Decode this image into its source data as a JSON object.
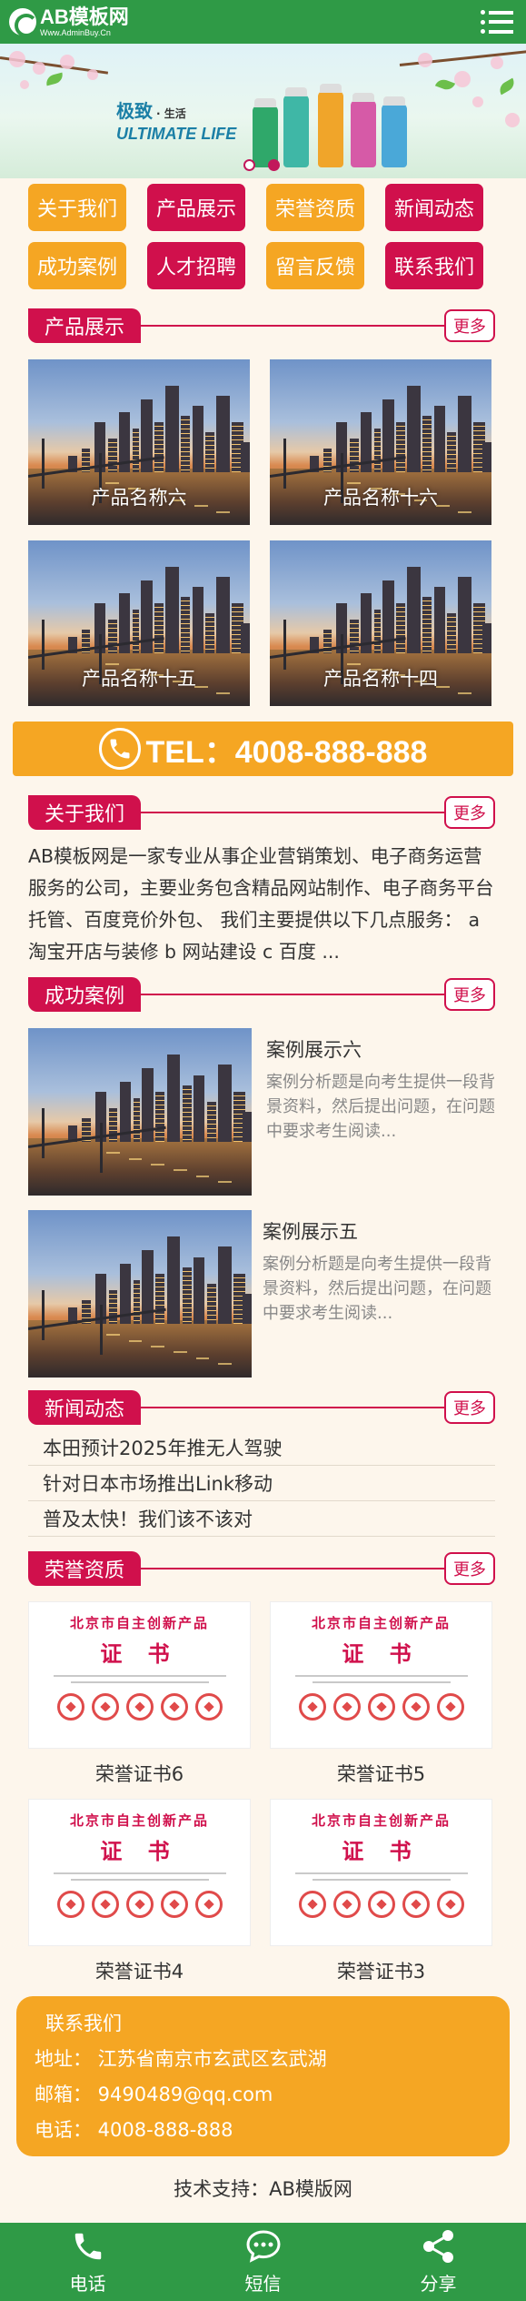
{
  "header": {
    "logo_name": "AB模板网",
    "logo_url": "Www.AdminBuy.Cn",
    "menu_icon": "menu-icon"
  },
  "banner": {
    "title_cn": "极致",
    "title_cn_suffix": "· 生活",
    "title_en": "ULTIMATE LIFE",
    "active_slide": 2,
    "slide_count": 2
  },
  "nav": {
    "items": [
      {
        "label": "关于我们",
        "color": "#f5a623"
      },
      {
        "label": "产品展示",
        "color": "#d0104c"
      },
      {
        "label": "荣誉资质",
        "color": "#f5a623"
      },
      {
        "label": "新闻动态",
        "color": "#d0104c"
      },
      {
        "label": "成功案例",
        "color": "#f5a623"
      },
      {
        "label": "人才招聘",
        "color": "#d0104c"
      },
      {
        "label": "留言反馈",
        "color": "#f5a623"
      },
      {
        "label": "联系我们",
        "color": "#d0104c"
      }
    ]
  },
  "sections": {
    "products": {
      "title": "产品展示",
      "more": "更多"
    },
    "about": {
      "title": "关于我们",
      "more": "更多"
    },
    "cases": {
      "title": "成功案例",
      "more": "更多"
    },
    "news": {
      "title": "新闻动态",
      "more": "更多"
    },
    "honors": {
      "title": "荣誉资质",
      "more": "更多"
    }
  },
  "products": [
    {
      "name": "产品名称六"
    },
    {
      "name": "产品名称十六"
    },
    {
      "name": "产品名称十五"
    },
    {
      "name": "产品名称十四"
    }
  ],
  "tel": {
    "text": "TEL：4008-888-888",
    "icon": "phone-icon"
  },
  "about": {
    "text": "AB模板网是一家专业从事企业营销策划、电子商务运营服务的公司，主要业务包含精品网站制作、电子商务平台托管、百度竞价外包、 我们主要提供以下几点服务： a 淘宝开店与装修 b 网站建设 c 百度 ..."
  },
  "cases": [
    {
      "title": "案例展示六",
      "desc": "案例分析题是向考生提供一段背景资料，然后提出问题，在问题中要求考生阅读..."
    },
    {
      "title": "案例展示五",
      "desc": "案例分析题是向考生提供一段背景资料，然后提出问题，在问题中要求考生阅读..."
    }
  ],
  "news": [
    {
      "title": "本田预计2025年推无人驾驶"
    },
    {
      "title": "针对日本市场推出Link移动"
    },
    {
      "title": "普及太快！我们该不该对"
    }
  ],
  "honors": [
    {
      "name": "荣誉证书6",
      "cert_header": "北京市自主创新产品",
      "cert_title": "证 书"
    },
    {
      "name": "荣誉证书5",
      "cert_header": "北京市自主创新产品",
      "cert_title": "证 书"
    },
    {
      "name": "荣誉证书4",
      "cert_header": "北京市自主创新产品",
      "cert_title": "证 书"
    },
    {
      "name": "荣誉证书3",
      "cert_header": "北京市自主创新产品",
      "cert_title": "证 书"
    }
  ],
  "contact": {
    "title": "联系我们",
    "address": "地址： 江苏省南京市玄武区玄武湖",
    "email": "邮箱： 9490489@qq.com",
    "phone": "电话： 4008-888-888"
  },
  "support": "技术支持：AB模版网",
  "bottom_bar": [
    {
      "label": "电话",
      "icon": "phone-icon"
    },
    {
      "label": "短信",
      "icon": "message-icon"
    },
    {
      "label": "分享",
      "icon": "share-icon"
    }
  ],
  "colors": {
    "header_green": "#2f9a46",
    "accent_red": "#d0104c",
    "accent_orange": "#f5a623",
    "page_bg": "#fdf6ec"
  }
}
